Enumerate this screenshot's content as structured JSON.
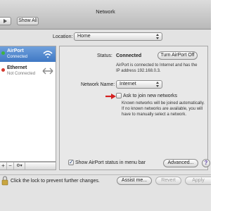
{
  "window": {
    "title": "Network"
  },
  "toolbar": {
    "show_all_label": "Show All",
    "nav_icon": "arrow-right-icon"
  },
  "location": {
    "label": "Location:",
    "value": "Home"
  },
  "services": [
    {
      "name": "AirPort",
      "status": "Connected",
      "status_color": "#3fb33f",
      "icon": "wifi-icon",
      "selected": true
    },
    {
      "name": "Ethernet",
      "status": "Not Connected",
      "status_color": "#d43a2f",
      "icon": "ethernet-icon",
      "selected": false
    }
  ],
  "sidebar_controls": {
    "add": "+",
    "remove": "−",
    "action": "⚙▾"
  },
  "status": {
    "label": "Status:",
    "value": "Connected",
    "button": "Turn AirPort Off",
    "description": "AirPort is connected to Internet and has the IP address 192.168.0.3."
  },
  "network_name": {
    "label": "Network Name:",
    "value": "Internet"
  },
  "ask_join": {
    "label": "Ask to join new networks",
    "checked": false,
    "description": "Known networks will be joined automatically. If no known networks are available, you will have to manually select a network."
  },
  "show_status": {
    "label": "Show AirPort status in menu bar",
    "checked": true
  },
  "advanced_button": "Advanced...",
  "help_button": "?",
  "footer": {
    "lock_text": "Click the lock to prevent further changes.",
    "assist_button": "Assist me...",
    "revert_button": "Revert",
    "apply_button": "Apply"
  },
  "colors": {
    "selection": "#3f78c4",
    "callout_arrow": "#d42020",
    "help_accent": "#5a3fa0"
  }
}
